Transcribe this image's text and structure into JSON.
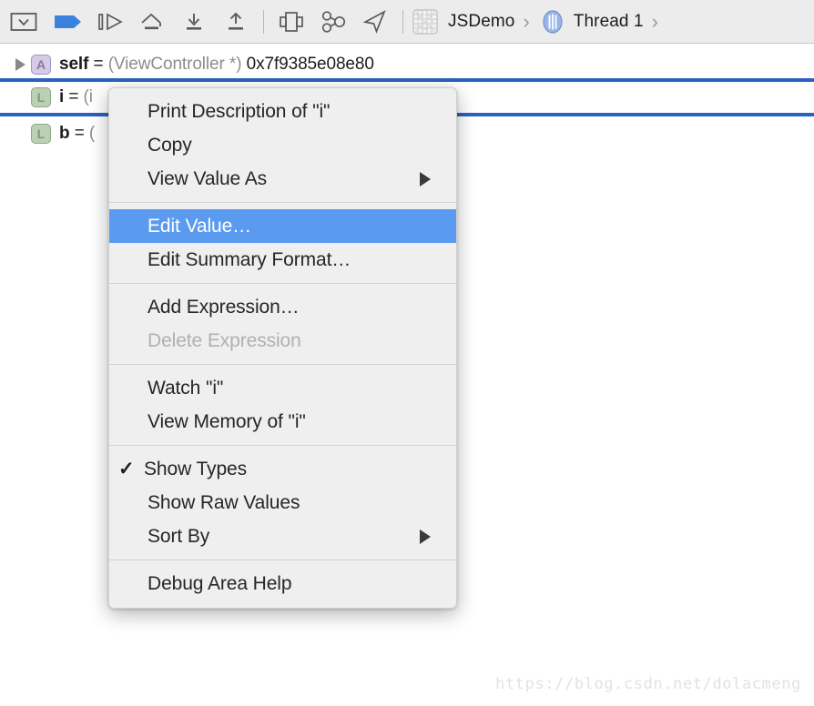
{
  "toolbar": {
    "buttons": [
      {
        "name": "hide-debug-area-button",
        "icon": "panel-collapse-icon",
        "label": "Hide Debug Area"
      },
      {
        "name": "breakpoints-activate-button",
        "icon": "breakpoint-arrow-icon",
        "label": "Deactivate Breakpoints"
      },
      {
        "name": "continue-button",
        "icon": "continue-program-icon",
        "label": "Continue program execution"
      },
      {
        "name": "step-over-button",
        "icon": "step-over-icon",
        "label": "Step over"
      },
      {
        "name": "step-into-button",
        "icon": "step-into-icon",
        "label": "Step into"
      },
      {
        "name": "step-out-button",
        "icon": "step-out-icon",
        "label": "Step out"
      },
      {
        "name": "debug-view-hierarchy-button",
        "icon": "view-hierarchy-icon",
        "label": "Debug View Hierarchy"
      },
      {
        "name": "memory-graph-button",
        "icon": "memory-graph-icon",
        "label": "Debug Memory Graph"
      },
      {
        "name": "simulate-location-button",
        "icon": "location-arrow-icon",
        "label": "Simulate Location"
      }
    ],
    "breadcrumb": {
      "grid_icon": "grid-thumbnail-icon",
      "process_label": "JSDemo",
      "separator": "›",
      "thread_icon": "thread-icon",
      "thread_label": "Thread 1",
      "trailing_separator": "›"
    }
  },
  "variables": {
    "rows": [
      {
        "name_id": "self",
        "badge": "A",
        "badge_kind": "argument",
        "has_disclosure": true,
        "expanded": false,
        "selected": false,
        "eq": " = ",
        "type": "(ViewController *)",
        "value": "0x7f9385e08e80"
      },
      {
        "name_id": "i",
        "badge": "L",
        "badge_kind": "local",
        "has_disclosure": false,
        "expanded": false,
        "selected": true,
        "eq": " = ",
        "type": "(i",
        "value": ""
      },
      {
        "name_id": "b",
        "badge": "L",
        "badge_kind": "local",
        "has_disclosure": false,
        "expanded": false,
        "selected": false,
        "eq": " = ",
        "type": "(",
        "value": ""
      }
    ]
  },
  "context_menu": {
    "groups": [
      {
        "items": [
          {
            "label": "Print Description of \"i\"",
            "name": "menu-item-print-description",
            "checked": false,
            "disabled": false,
            "highlighted": false,
            "submenu": false
          },
          {
            "label": "Copy",
            "name": "menu-item-copy",
            "checked": false,
            "disabled": false,
            "highlighted": false,
            "submenu": false
          },
          {
            "label": "View Value As",
            "name": "menu-item-view-value-as",
            "checked": false,
            "disabled": false,
            "highlighted": false,
            "submenu": true
          }
        ]
      },
      {
        "items": [
          {
            "label": "Edit Value…",
            "name": "menu-item-edit-value",
            "checked": false,
            "disabled": false,
            "highlighted": true,
            "submenu": false
          },
          {
            "label": "Edit Summary Format…",
            "name": "menu-item-edit-summary-format",
            "checked": false,
            "disabled": false,
            "highlighted": false,
            "submenu": false
          }
        ]
      },
      {
        "items": [
          {
            "label": "Add Expression…",
            "name": "menu-item-add-expression",
            "checked": false,
            "disabled": false,
            "highlighted": false,
            "submenu": false
          },
          {
            "label": "Delete Expression",
            "name": "menu-item-delete-expression",
            "checked": false,
            "disabled": true,
            "highlighted": false,
            "submenu": false
          }
        ]
      },
      {
        "items": [
          {
            "label": "Watch \"i\"",
            "name": "menu-item-watch",
            "checked": false,
            "disabled": false,
            "highlighted": false,
            "submenu": false
          },
          {
            "label": "View Memory of \"i\"",
            "name": "menu-item-view-memory",
            "checked": false,
            "disabled": false,
            "highlighted": false,
            "submenu": false
          }
        ]
      },
      {
        "items": [
          {
            "label": "Show Types",
            "name": "menu-item-show-types",
            "checked": true,
            "disabled": false,
            "highlighted": false,
            "submenu": false
          },
          {
            "label": "Show Raw Values",
            "name": "menu-item-show-raw-values",
            "checked": false,
            "disabled": false,
            "highlighted": false,
            "submenu": false
          },
          {
            "label": "Sort By",
            "name": "menu-item-sort-by",
            "checked": false,
            "disabled": false,
            "highlighted": false,
            "submenu": true
          }
        ]
      },
      {
        "items": [
          {
            "label": "Debug Area Help",
            "name": "menu-item-debug-area-help",
            "checked": false,
            "disabled": false,
            "highlighted": false,
            "submenu": false
          }
        ]
      }
    ],
    "checkmark_glyph": "✓"
  },
  "watermark": {
    "text": "https://blog.csdn.net/dolacmeng"
  },
  "colors": {
    "selection_line": "#2a62c0",
    "menu_highlight": "#5a9bf0",
    "breakpoint_blue": "#3b82e0",
    "toolbar_bg": "#ececec",
    "menu_bg": "#efefef"
  }
}
